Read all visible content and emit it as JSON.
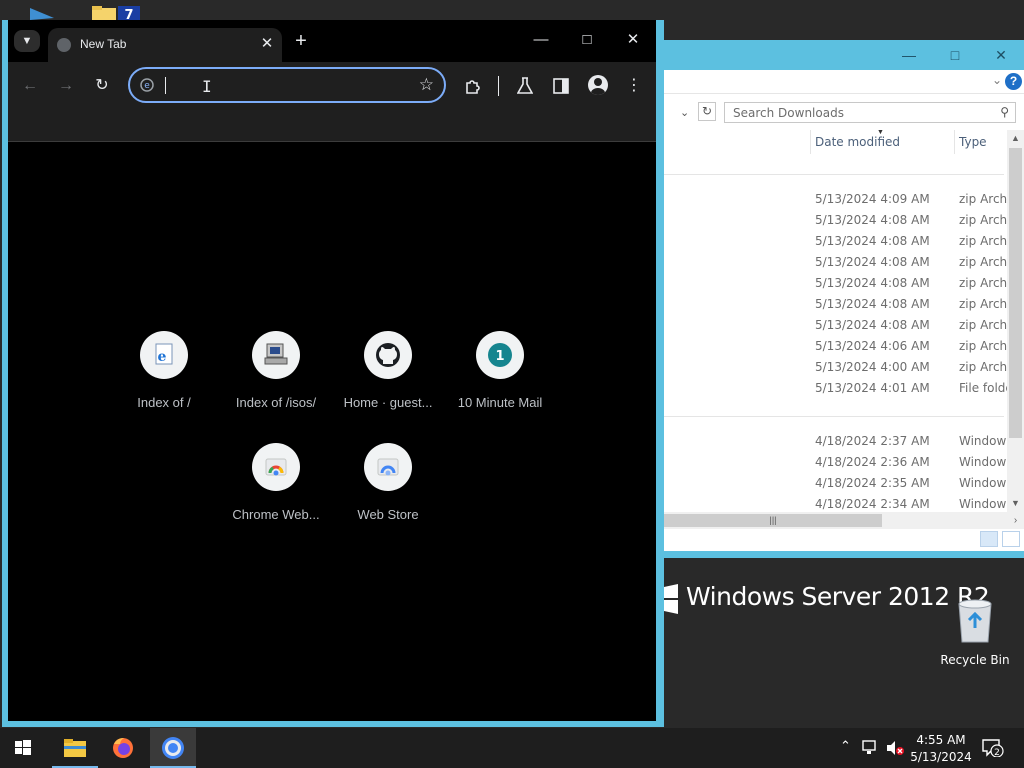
{
  "browser": {
    "tab_title": "New Tab",
    "omnibox_value": "",
    "shortcuts": [
      {
        "label": "Index of /",
        "icon": "ie-page-icon"
      },
      {
        "label": "Index of /isos/",
        "icon": "old-computer-icon"
      },
      {
        "label": "Home · guest...",
        "icon": "github-icon"
      },
      {
        "label": "10 Minute Mail",
        "icon": "ten-minute-mail-icon",
        "badge": "1"
      },
      {
        "label": "Chrome Web...",
        "icon": "chrome-web-store-icon"
      },
      {
        "label": "Web Store",
        "icon": "web-store-icon"
      }
    ]
  },
  "explorer": {
    "search_placeholder": "Search Downloads",
    "columns": {
      "date": "Date modified",
      "type": "Type"
    },
    "rows": [
      {
        "date": "5/13/2024 4:09 AM",
        "type": "zip Archive"
      },
      {
        "date": "5/13/2024 4:08 AM",
        "type": "zip Archive"
      },
      {
        "date": "5/13/2024 4:08 AM",
        "type": "zip Archive"
      },
      {
        "date": "5/13/2024 4:08 AM",
        "type": "zip Archive"
      },
      {
        "date": "5/13/2024 4:08 AM",
        "type": "zip Archive"
      },
      {
        "date": "5/13/2024 4:08 AM",
        "type": "zip Archive"
      },
      {
        "date": "5/13/2024 4:08 AM",
        "type": "zip Archive"
      },
      {
        "date": "5/13/2024 4:06 AM",
        "type": "zip Archive"
      },
      {
        "date": "5/13/2024 4:00 AM",
        "type": "zip Archive"
      },
      {
        "date": "5/13/2024 4:01 AM",
        "type": "File folder"
      }
    ],
    "rows2": [
      {
        "date": "4/18/2024 2:37 AM",
        "type": "Windows"
      },
      {
        "date": "4/18/2024 2:36 AM",
        "type": "Windows"
      },
      {
        "date": "4/18/2024 2:35 AM",
        "type": "Windows"
      },
      {
        "date": "4/18/2024 2:34 AM",
        "type": "Windows"
      }
    ]
  },
  "desktop": {
    "branding": "Windows Server 2012 R2",
    "recycle_bin_label": "Recycle Bin"
  },
  "taskbar": {
    "time": "4:55 AM",
    "date": "5/13/2024",
    "notification_count": "2"
  },
  "colors": {
    "window_frame": "#5cc0e0",
    "omnibox_focus": "#7cacf8",
    "taskbar_bg": "#1e1e1e"
  }
}
